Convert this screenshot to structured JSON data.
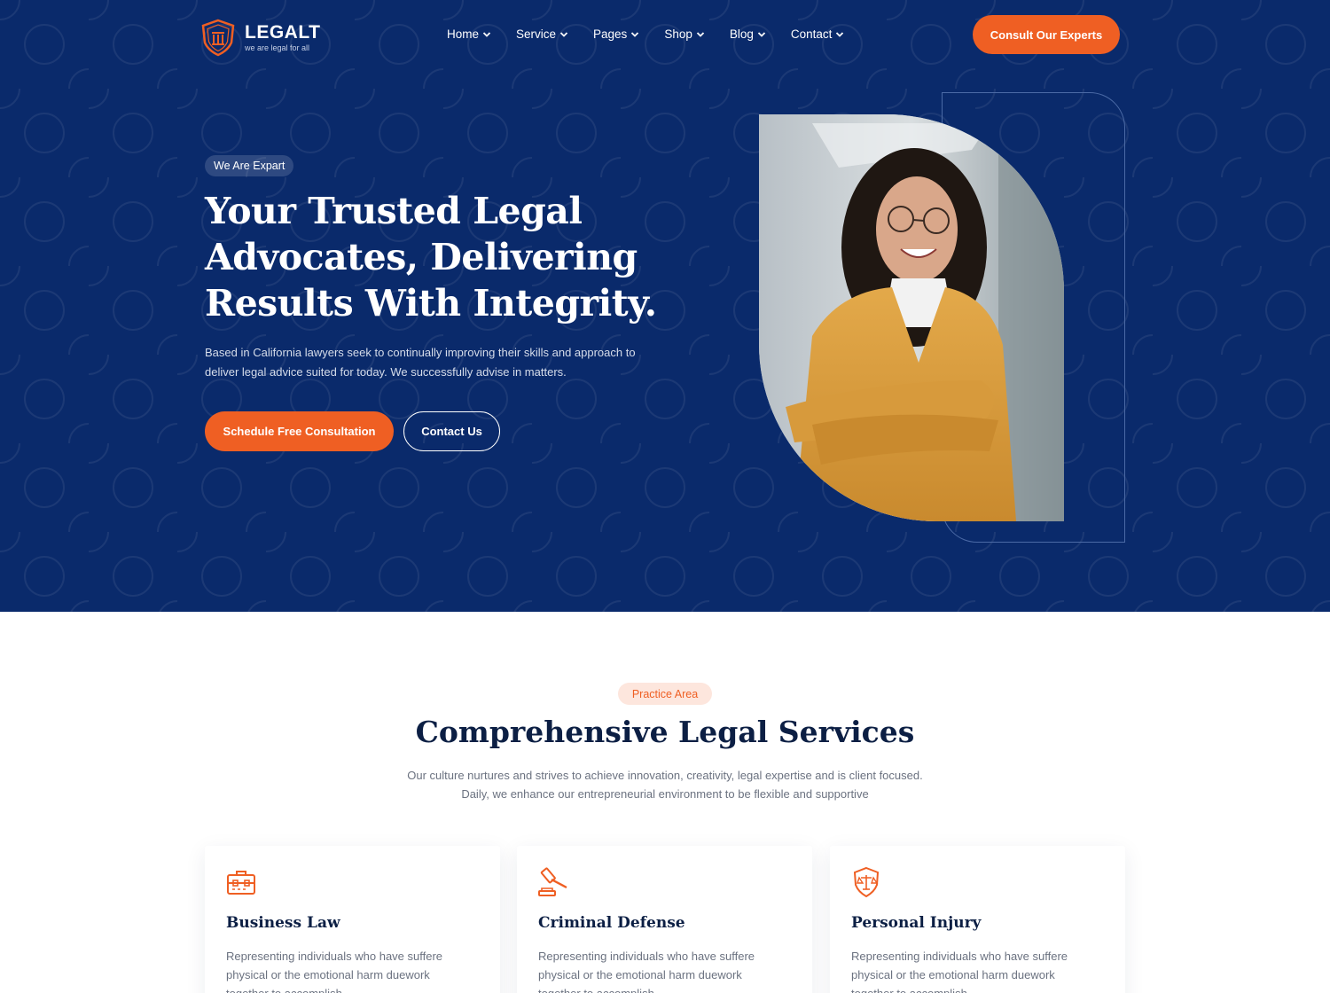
{
  "brand": {
    "name": "LEGALT",
    "tagline": "we are legal for all"
  },
  "nav": {
    "items": [
      {
        "label": "Home"
      },
      {
        "label": "Service"
      },
      {
        "label": "Pages"
      },
      {
        "label": "Shop"
      },
      {
        "label": "Blog"
      },
      {
        "label": "Contact"
      }
    ],
    "cta_label": "Consult Our Experts"
  },
  "hero": {
    "badge": "We Are Expart",
    "title": "Your Trusted Legal Advocates, Delivering Results With Integrity.",
    "description": "Based in California lawyers seek to continually improving their skills and approach to deliver legal advice suited for today. We successfully advise in matters.",
    "primary_button": "Schedule Free Consultation",
    "secondary_button": "Contact Us"
  },
  "practice": {
    "badge": "Practice Area",
    "title": "Comprehensive Legal Services",
    "description": "Our culture nurtures and strives to achieve innovation, creativity, legal expertise and is client focused. Daily, we enhance our entrepreneurial environment to be flexible and supportive",
    "cards": [
      {
        "icon": "briefcase-icon",
        "title": "Business Law",
        "text": "Representing individuals who have suffere physical or the emotional harm duework together to accomplish"
      },
      {
        "icon": "gavel-icon",
        "title": "Criminal Defense",
        "text": "Representing individuals who have suffere physical or the emotional harm duework together to accomplish"
      },
      {
        "icon": "shield-scale-icon",
        "title": "Personal Injury",
        "text": "Representing individuals who have suffere physical or the emotional harm duework together to accomplish"
      }
    ]
  },
  "colors": {
    "hero_bg": "#0a2a6b",
    "accent": "#ef5f23",
    "heading": "#0c1f44"
  }
}
